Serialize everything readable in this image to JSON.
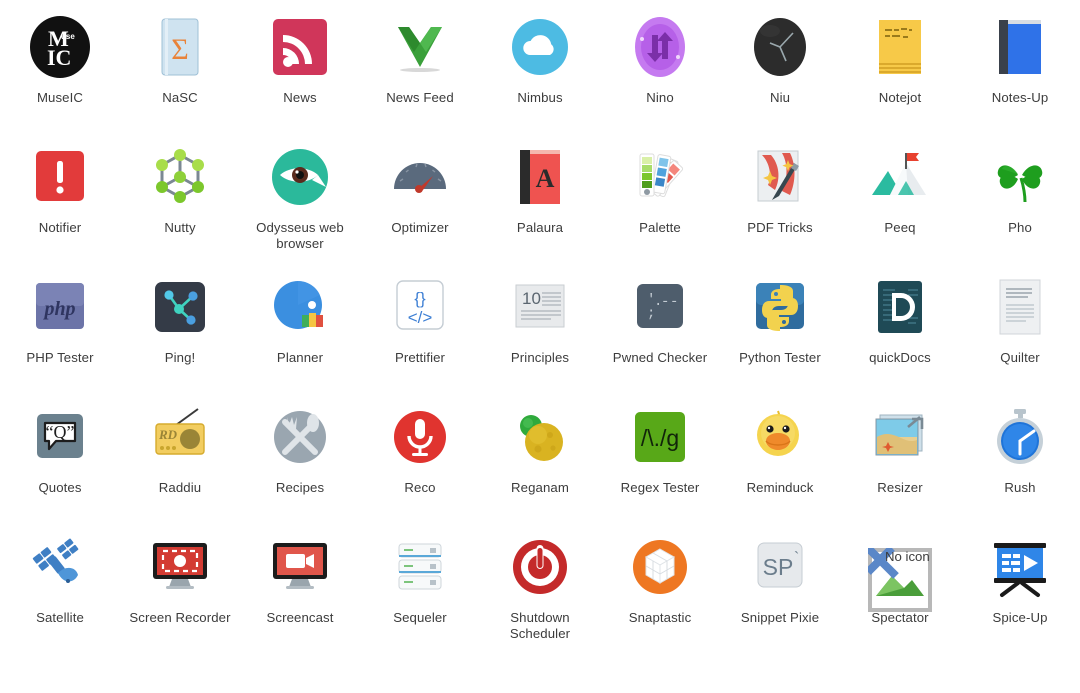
{
  "view": {
    "background": "#ffffff",
    "label_color": "#3c3c3c",
    "columns": 9,
    "rows": 5
  },
  "apps": [
    {
      "label": "MuseIC",
      "icon": "museic-icon"
    },
    {
      "label": "NaSC",
      "icon": "nasc-icon"
    },
    {
      "label": "News",
      "icon": "news-rss-icon"
    },
    {
      "label": "News Feed",
      "icon": "news-feed-icon"
    },
    {
      "label": "Nimbus",
      "icon": "nimbus-cloud-icon"
    },
    {
      "label": "Nino",
      "icon": "nino-sync-arrows-icon"
    },
    {
      "label": "Niu",
      "icon": "niu-clock-icon"
    },
    {
      "label": "Notejot",
      "icon": "notejot-sticky-note-icon"
    },
    {
      "label": "Notes-Up",
      "icon": "notes-up-book-icon"
    },
    {
      "label": "Notifier",
      "icon": "notifier-exclamation-icon"
    },
    {
      "label": "Nutty",
      "icon": "nutty-network-icon"
    },
    {
      "label": "Odysseus web browser",
      "icon": "odysseus-eye-icon"
    },
    {
      "label": "Optimizer",
      "icon": "optimizer-gauge-icon"
    },
    {
      "label": "Palaura",
      "icon": "palaura-dictionary-icon"
    },
    {
      "label": "Palette",
      "icon": "palette-swatches-icon"
    },
    {
      "label": "PDF Tricks",
      "icon": "pdf-tricks-wand-icon"
    },
    {
      "label": "Peeq",
      "icon": "peeq-mountain-flag-icon"
    },
    {
      "label": "Pho",
      "icon": "pho-clover-icon"
    },
    {
      "label": "PHP Tester",
      "icon": "php-tester-icon"
    },
    {
      "label": "Ping!",
      "icon": "ping-nodes-icon"
    },
    {
      "label": "Planner",
      "icon": "planner-icon"
    },
    {
      "label": "Prettifier",
      "icon": "prettifier-code-icon"
    },
    {
      "label": "Principles",
      "icon": "principles-list-icon"
    },
    {
      "label": "Pwned Checker",
      "icon": "pwned-checker-icon"
    },
    {
      "label": "Python Tester",
      "icon": "python-tester-icon"
    },
    {
      "label": "quickDocs",
      "icon": "quickdocs-icon"
    },
    {
      "label": "Quilter",
      "icon": "quilter-document-icon"
    },
    {
      "label": "Quotes",
      "icon": "quotes-bubble-icon"
    },
    {
      "label": "Raddiu",
      "icon": "raddiu-radio-icon"
    },
    {
      "label": "Recipes",
      "icon": "recipes-cutlery-icon"
    },
    {
      "label": "Reco",
      "icon": "reco-microphone-icon"
    },
    {
      "label": "Reganam",
      "icon": "reganam-spheres-icon"
    },
    {
      "label": "Regex Tester",
      "icon": "regex-tester-icon"
    },
    {
      "label": "Reminduck",
      "icon": "reminduck-duck-icon"
    },
    {
      "label": "Resizer",
      "icon": "resizer-image-icon"
    },
    {
      "label": "Rush",
      "icon": "rush-stopwatch-icon"
    },
    {
      "label": "Satellite",
      "icon": "satellite-icon"
    },
    {
      "label": "Screen Recorder",
      "icon": "screen-recorder-icon"
    },
    {
      "label": "Screencast",
      "icon": "screencast-icon"
    },
    {
      "label": "Sequeler",
      "icon": "sequeler-database-icon"
    },
    {
      "label": "Shutdown Scheduler",
      "icon": "shutdown-scheduler-icon"
    },
    {
      "label": "Snaptastic",
      "icon": "snaptastic-box-icon"
    },
    {
      "label": "Snippet Pixie",
      "icon": "snippet-pixie-icon"
    },
    {
      "label": "Spectator",
      "icon": "broken-image-icon",
      "missing_icon_text": "No icon"
    },
    {
      "label": "Spice-Up",
      "icon": "spice-up-presentation-icon"
    }
  ]
}
